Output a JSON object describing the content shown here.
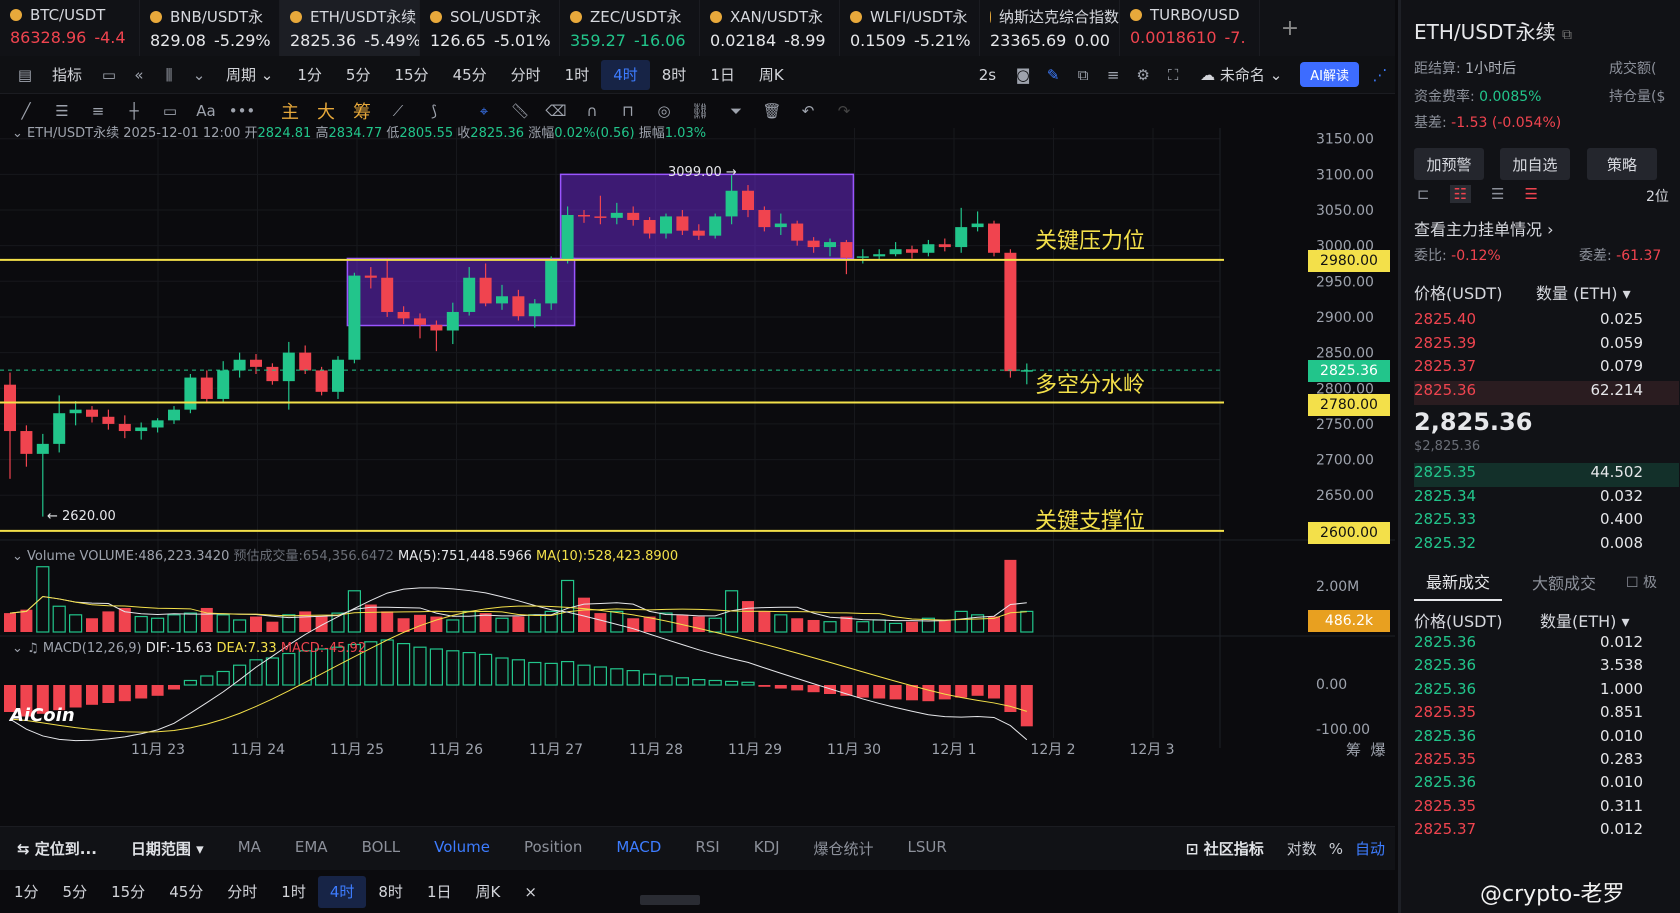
{
  "tickers": [
    {
      "symbol": "BTC/USDT",
      "price": "86328.96",
      "change": "-4.4",
      "color": "red"
    },
    {
      "symbol": "BNB/USDT永",
      "price": "829.08",
      "change": "-5.29%",
      "color": "white"
    },
    {
      "symbol": "ETH/USDT永续",
      "price": "2825.36",
      "change": "-5.49%",
      "color": "white",
      "active": true
    },
    {
      "symbol": "SOL/USDT永",
      "price": "126.65",
      "change": "-5.01%",
      "color": "white"
    },
    {
      "symbol": "ZEC/USDT永",
      "price": "359.27",
      "change": "-16.06",
      "color": "green"
    },
    {
      "symbol": "XAN/USDT永",
      "price": "0.02184",
      "change": "-8.99",
      "color": "white"
    },
    {
      "symbol": "WLFI/USDT永",
      "price": "0.1509",
      "change": "-5.21%",
      "color": "white"
    },
    {
      "symbol": "纳斯达克综合指数",
      "price": "23365.69",
      "change": "0.00",
      "color": "white"
    },
    {
      "symbol": "TURBO/USD",
      "price": "0.0018610",
      "change": "-7.",
      "color": "red"
    }
  ],
  "toolbar": {
    "indicator": "指标",
    "period": "周期",
    "intervals": [
      "1分",
      "5分",
      "15分",
      "45分",
      "分时",
      "1时",
      "4时",
      "8时",
      "1日",
      "周K"
    ],
    "selected_interval": "4时",
    "refresh": "2s",
    "layout_name": "未命名",
    "ai_button": "AI解读"
  },
  "drawbar": {
    "labels": [
      "主",
      "大",
      "筹"
    ],
    "text_tool": "Aa"
  },
  "chart_info": {
    "symbol": "ETH/USDT永续",
    "datetime": "2025-12-01 12:00",
    "open_label": "开",
    "open": "2824.81",
    "high_label": "高",
    "high": "2834.77",
    "low_label": "低",
    "low": "2805.55",
    "close_label": "收",
    "close": "2825.36",
    "change_label": "涨幅",
    "change": "0.02%(0.56)",
    "amp_label": "振幅",
    "amp": "1.03%"
  },
  "volume_info": {
    "label": "Volume",
    "volume": "VOLUME:486,223.3420",
    "est": "预估成交量:654,356.6472",
    "ma5": "MA(5):751,448.5966",
    "ma10": "MA(10):528,423.8900",
    "axis_top": "2.00M",
    "current": "486.2k"
  },
  "macd_info": {
    "label": "MACD(12,26,9)",
    "dif": "DIF:-15.63",
    "dea": "DEA:7.33",
    "macd": "MACD:-45.92",
    "axis_zero": "0.00",
    "axis_low": "-100.00"
  },
  "annotations": {
    "resistance": "关键压力位",
    "pivot": "多空分水岭",
    "support": "关键支撑位",
    "high_marker": "3099.00 →",
    "low_marker": "← 2620.00"
  },
  "price_tags": {
    "resistance": "2980.00",
    "current": "2825.36",
    "pivot": "2780.00",
    "support": "2600.00"
  },
  "colors": {
    "up": "#22c58b",
    "down": "#f0444f",
    "level_line": "#f3e04a",
    "box": "#7b2cf0",
    "accent": "#3d7cff"
  },
  "logo": "AiCoin",
  "chart_data": {
    "type": "candlestick",
    "interval": "4时",
    "y_ticks": [
      3150,
      3100,
      3050,
      3000,
      2950,
      2900,
      2850,
      2800,
      2750,
      2700,
      2650
    ],
    "ylim": [
      2590,
      3165
    ],
    "x_labels": [
      "11月 23",
      "11月 24",
      "11月 25",
      "11月 26",
      "11月 27",
      "11月 28",
      "11月 29",
      "11月 30",
      "12月 1",
      "12月 2",
      "12月 3"
    ],
    "levels": [
      2980,
      2780,
      2600
    ],
    "current_price": 2825.36,
    "boxes": [
      {
        "from_candle": 21,
        "to_candle": 34,
        "low": 2888,
        "high": 2982
      },
      {
        "from_candle": 34,
        "to_candle": 51,
        "low": 2982,
        "high": 3100
      }
    ],
    "candles": [
      {
        "o": 2805,
        "c": 2740,
        "h": 2822,
        "l": 2673
      },
      {
        "o": 2740,
        "c": 2708,
        "h": 2748,
        "l": 2690
      },
      {
        "o": 2708,
        "c": 2722,
        "h": 2736,
        "l": 2620
      },
      {
        "o": 2722,
        "c": 2765,
        "h": 2790,
        "l": 2710
      },
      {
        "o": 2765,
        "c": 2770,
        "h": 2782,
        "l": 2748
      },
      {
        "o": 2770,
        "c": 2760,
        "h": 2775,
        "l": 2752
      },
      {
        "o": 2760,
        "c": 2750,
        "h": 2770,
        "l": 2742
      },
      {
        "o": 2750,
        "c": 2740,
        "h": 2762,
        "l": 2730
      },
      {
        "o": 2740,
        "c": 2745,
        "h": 2752,
        "l": 2728
      },
      {
        "o": 2745,
        "c": 2755,
        "h": 2758,
        "l": 2738
      },
      {
        "o": 2755,
        "c": 2770,
        "h": 2775,
        "l": 2750
      },
      {
        "o": 2770,
        "c": 2815,
        "h": 2820,
        "l": 2765
      },
      {
        "o": 2815,
        "c": 2785,
        "h": 2825,
        "l": 2780
      },
      {
        "o": 2785,
        "c": 2825,
        "h": 2838,
        "l": 2780
      },
      {
        "o": 2825,
        "c": 2840,
        "h": 2850,
        "l": 2815
      },
      {
        "o": 2840,
        "c": 2830,
        "h": 2848,
        "l": 2820
      },
      {
        "o": 2830,
        "c": 2810,
        "h": 2835,
        "l": 2805
      },
      {
        "o": 2810,
        "c": 2850,
        "h": 2865,
        "l": 2770
      },
      {
        "o": 2850,
        "c": 2825,
        "h": 2860,
        "l": 2820
      },
      {
        "o": 2825,
        "c": 2795,
        "h": 2830,
        "l": 2790
      },
      {
        "o": 2795,
        "c": 2840,
        "h": 2845,
        "l": 2785
      },
      {
        "o": 2840,
        "c": 2958,
        "h": 2962,
        "l": 2835
      },
      {
        "o": 2958,
        "c": 2955,
        "h": 2970,
        "l": 2940
      },
      {
        "o": 2955,
        "c": 2907,
        "h": 2982,
        "l": 2900
      },
      {
        "o": 2907,
        "c": 2898,
        "h": 2915,
        "l": 2890
      },
      {
        "o": 2898,
        "c": 2889,
        "h": 2905,
        "l": 2870
      },
      {
        "o": 2889,
        "c": 2881,
        "h": 2895,
        "l": 2852
      },
      {
        "o": 2881,
        "c": 2907,
        "h": 2920,
        "l": 2862
      },
      {
        "o": 2907,
        "c": 2955,
        "h": 2970,
        "l": 2902
      },
      {
        "o": 2955,
        "c": 2919,
        "h": 2975,
        "l": 2915
      },
      {
        "o": 2919,
        "c": 2929,
        "h": 2945,
        "l": 2910
      },
      {
        "o": 2929,
        "c": 2901,
        "h": 2938,
        "l": 2895
      },
      {
        "o": 2901,
        "c": 2919,
        "h": 2925,
        "l": 2885
      },
      {
        "o": 2919,
        "c": 2979,
        "h": 2985,
        "l": 2910
      },
      {
        "o": 2979,
        "c": 3043,
        "h": 3055,
        "l": 2975
      },
      {
        "o": 3043,
        "c": 3041,
        "h": 3050,
        "l": 3032
      },
      {
        "o": 3041,
        "c": 3039,
        "h": 3070,
        "l": 3030
      },
      {
        "o": 3039,
        "c": 3046,
        "h": 3060,
        "l": 3030
      },
      {
        "o": 3046,
        "c": 3036,
        "h": 3055,
        "l": 3028
      },
      {
        "o": 3036,
        "c": 3017,
        "h": 3040,
        "l": 3010
      },
      {
        "o": 3017,
        "c": 3041,
        "h": 3045,
        "l": 3010
      },
      {
        "o": 3041,
        "c": 3021,
        "h": 3050,
        "l": 3015
      },
      {
        "o": 3021,
        "c": 3014,
        "h": 3030,
        "l": 3008
      },
      {
        "o": 3014,
        "c": 3041,
        "h": 3045,
        "l": 3010
      },
      {
        "o": 3041,
        "c": 3077,
        "h": 3099,
        "l": 3030
      },
      {
        "o": 3077,
        "c": 3050,
        "h": 3085,
        "l": 3040
      },
      {
        "o": 3050,
        "c": 3026,
        "h": 3055,
        "l": 3020
      },
      {
        "o": 3026,
        "c": 3031,
        "h": 3045,
        "l": 3015
      },
      {
        "o": 3031,
        "c": 3007,
        "h": 3035,
        "l": 3000
      },
      {
        "o": 3007,
        "c": 2998,
        "h": 3012,
        "l": 2990
      },
      {
        "o": 2998,
        "c": 3005,
        "h": 3010,
        "l": 2985
      },
      {
        "o": 3005,
        "c": 2983,
        "h": 3008,
        "l": 2960
      },
      {
        "o": 2983,
        "c": 2985,
        "h": 2995,
        "l": 2975
      },
      {
        "o": 2985,
        "c": 2988,
        "h": 2995,
        "l": 2980
      },
      {
        "o": 2988,
        "c": 2995,
        "h": 3005,
        "l": 2985
      },
      {
        "o": 2995,
        "c": 2990,
        "h": 3000,
        "l": 2982
      },
      {
        "o": 2990,
        "c": 3002,
        "h": 3008,
        "l": 2985
      },
      {
        "o": 3002,
        "c": 2998,
        "h": 3010,
        "l": 2992
      },
      {
        "o": 2998,
        "c": 3026,
        "h": 3053,
        "l": 2990
      },
      {
        "o": 3026,
        "c": 3031,
        "h": 3048,
        "l": 3020
      },
      {
        "o": 3031,
        "c": 2990,
        "h": 3035,
        "l": 2985
      },
      {
        "o": 2990,
        "c": 2824,
        "h": 2995,
        "l": 2815
      },
      {
        "o": 2824.81,
        "c": 2825.36,
        "h": 2834.77,
        "l": 2805.55
      }
    ],
    "volume": [
      55,
      65,
      190,
      75,
      50,
      40,
      60,
      70,
      45,
      40,
      50,
      55,
      70,
      50,
      35,
      45,
      30,
      50,
      60,
      45,
      55,
      120,
      80,
      60,
      40,
      50,
      45,
      35,
      60,
      55,
      40,
      45,
      50,
      60,
      150,
      100,
      55,
      60,
      40,
      45,
      55,
      50,
      45,
      40,
      120,
      90,
      60,
      50,
      40,
      35,
      30,
      45,
      30,
      35,
      25,
      30,
      40,
      35,
      60,
      50,
      45,
      210,
      60
    ],
    "macd_hist": [
      -30,
      -35,
      -32,
      -28,
      -25,
      -22,
      -20,
      -18,
      -15,
      -12,
      -5,
      5,
      10,
      15,
      22,
      28,
      30,
      35,
      38,
      40,
      42,
      45,
      48,
      50,
      46,
      42,
      40,
      38,
      36,
      34,
      30,
      28,
      25,
      24,
      26,
      22,
      20,
      18,
      16,
      12,
      10,
      8,
      6,
      5,
      4,
      3,
      -2,
      -4,
      -6,
      -8,
      -10,
      -12,
      -14,
      -15,
      -16,
      -17,
      -18,
      -16,
      -14,
      -12,
      -15,
      -30,
      -45.92
    ]
  },
  "right_panel": {
    "title": "ETH/USDT永续",
    "settle_label": "距结算:",
    "settle_value": "1小时后",
    "funding_label": "资金费率:",
    "funding_value": "0.0085%",
    "basis_label": "基差:",
    "basis_value": "-1.53 (-0.054%)",
    "turnover_label": "成交额(",
    "oi_label": "持仓量($",
    "buttons": [
      "加预警",
      "加自选",
      "策略"
    ],
    "depth_label": "2位",
    "main_orders": "查看主力挂单情况",
    "ratio_label": "委比:",
    "ratio_value": "-0.12%",
    "diff_label": "委差:",
    "diff_value": "-61.37",
    "ob_price_head": "价格(USDT)",
    "ob_qty_head": "数量 (ETH)",
    "asks": [
      {
        "price": "2825.40",
        "qty": "0.025"
      },
      {
        "price": "2825.39",
        "qty": "0.059"
      },
      {
        "price": "2825.37",
        "qty": "0.079"
      },
      {
        "price": "2825.36",
        "qty": "62.214"
      }
    ],
    "last_price": "2,825.36",
    "last_price_usd": "$2,825.36",
    "bids": [
      {
        "price": "2825.35",
        "qty": "44.502"
      },
      {
        "price": "2825.34",
        "qty": "0.032"
      },
      {
        "price": "2825.33",
        "qty": "0.400"
      },
      {
        "price": "2825.32",
        "qty": "0.008"
      }
    ],
    "trades_tab": "最新成交",
    "big_trades_tab": "大额成交",
    "extreme_label": "极",
    "trades_price_head": "价格(USDT)",
    "trades_qty_head": "数量(ETH)",
    "trades": [
      {
        "price": "2825.36",
        "qty": "0.012",
        "side": "buy"
      },
      {
        "price": "2825.36",
        "qty": "3.538",
        "side": "buy"
      },
      {
        "price": "2825.36",
        "qty": "1.000",
        "side": "buy"
      },
      {
        "price": "2825.35",
        "qty": "0.851",
        "side": "sell"
      },
      {
        "price": "2825.36",
        "qty": "0.010",
        "side": "buy"
      },
      {
        "price": "2825.35",
        "qty": "0.283",
        "side": "sell"
      },
      {
        "price": "2825.36",
        "qty": "0.010",
        "side": "buy"
      },
      {
        "price": "2825.35",
        "qty": "0.311",
        "side": "sell"
      },
      {
        "price": "2825.37",
        "qty": "0.012",
        "side": "sell"
      }
    ]
  },
  "bottom": {
    "locate": "定位到...",
    "date_range": "日期范围",
    "indicators": [
      "MA",
      "EMA",
      "BOLL",
      "Volume",
      "Position",
      "MACD",
      "RSI",
      "KDJ",
      "爆仓统计",
      "LSUR"
    ],
    "active_indicators": [
      "Volume",
      "MACD"
    ],
    "community": "社区指标",
    "log": "对数",
    "percent": "%",
    "auto": "自动",
    "intervals": [
      "1分",
      "5分",
      "15分",
      "45分",
      "分时",
      "1时",
      "4时",
      "8时",
      "1日",
      "周K"
    ],
    "selected_interval": "4时",
    "close": "×"
  },
  "watermark": "@crypto-老罗"
}
